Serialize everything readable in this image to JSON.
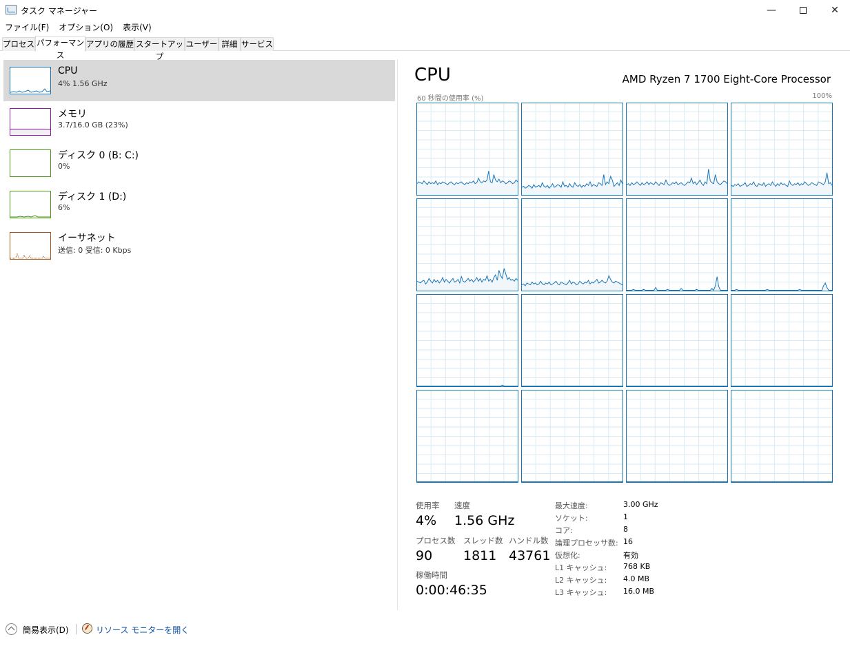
{
  "window": {
    "title": "タスク マネージャー",
    "min_symbol": "—",
    "close_symbol": "✕"
  },
  "menu": [
    "ファイル(F)",
    "オプション(O)",
    "表示(V)"
  ],
  "tabs": [
    "プロセス",
    "パフォーマンス",
    "アプリの履歴",
    "スタートアップ",
    "ユーザー",
    "詳細",
    "サービス"
  ],
  "active_tab": "パフォーマンス",
  "resources": [
    {
      "name": "CPU",
      "sub": "4%  1.56 GHz",
      "color": "#1b76b8",
      "selected": true
    },
    {
      "name": "メモリ",
      "sub": "3.7/16.0 GB (23%)",
      "color": "#8b18a6",
      "selected": false
    },
    {
      "name": "ディスク 0 (B: C:)",
      "sub": "0%",
      "color": "#4d9a16",
      "selected": false
    },
    {
      "name": "ディスク 1 (D:)",
      "sub": "6%",
      "color": "#4d9a16",
      "selected": false
    },
    {
      "name": "イーサネット",
      "sub": "送信: 0 受信: 0 Kbps",
      "color": "#a7581e",
      "selected": false
    }
  ],
  "detail": {
    "title": "CPU",
    "model": "AMD Ryzen 7 1700 Eight-Core Processor",
    "graph_label": "60 秒間の使用率 (%)",
    "graph_max": "100%",
    "graph_color": "#1b76b8",
    "grid_color": "#d9eaf7"
  },
  "core_activity": [
    [
      12,
      14,
      13,
      12,
      15,
      13,
      11,
      14,
      12,
      13,
      12,
      15,
      11,
      13,
      12,
      14,
      13,
      12,
      11,
      13,
      14,
      12,
      11,
      13,
      12,
      13,
      14,
      12,
      11,
      13,
      12,
      14,
      13,
      15,
      12,
      13,
      18,
      14,
      13,
      15,
      14,
      16,
      26,
      14,
      13,
      22,
      16,
      14,
      17,
      13,
      15,
      14,
      12,
      13,
      15,
      14,
      12,
      13,
      16,
      14
    ],
    [
      8,
      9,
      7,
      8,
      10,
      9,
      7,
      11,
      8,
      9,
      10,
      8,
      13,
      9,
      8,
      10,
      7,
      9,
      12,
      8,
      9,
      11,
      10,
      8,
      14,
      9,
      10,
      8,
      12,
      9,
      8,
      13,
      10,
      9,
      11,
      8,
      10,
      9,
      12,
      10,
      14,
      9,
      11,
      10,
      9,
      13,
      12,
      10,
      22,
      11,
      14,
      12,
      20,
      16,
      9,
      11,
      13,
      10,
      16,
      12
    ],
    [
      11,
      12,
      10,
      13,
      11,
      12,
      14,
      12,
      10,
      13,
      11,
      12,
      14,
      11,
      13,
      12,
      11,
      14,
      12,
      10,
      13,
      12,
      11,
      16,
      12,
      10,
      11,
      13,
      12,
      14,
      11,
      12,
      13,
      11,
      10,
      12,
      14,
      13,
      18,
      12,
      14,
      11,
      13,
      16,
      12,
      10,
      14,
      12,
      28,
      15,
      13,
      12,
      22,
      14,
      12,
      11,
      13,
      15,
      14,
      12
    ],
    [
      10,
      9,
      11,
      10,
      12,
      9,
      10,
      11,
      13,
      9,
      10,
      12,
      11,
      14,
      10,
      9,
      12,
      11,
      10,
      13,
      9,
      11,
      12,
      10,
      14,
      11,
      9,
      12,
      10,
      13,
      11,
      12,
      10,
      9,
      15,
      11,
      10,
      12,
      11,
      13,
      10,
      12,
      11,
      14,
      12,
      10,
      11,
      13,
      12,
      11,
      10,
      14,
      13,
      12,
      11,
      14,
      24,
      12,
      13,
      10
    ],
    [
      10,
      9,
      8,
      10,
      11,
      7,
      9,
      13,
      10,
      8,
      12,
      9,
      11,
      8,
      10,
      14,
      9,
      12,
      10,
      8,
      11,
      13,
      9,
      10,
      12,
      8,
      15,
      10,
      9,
      11,
      13,
      10,
      12,
      9,
      11,
      14,
      10,
      13,
      9,
      12,
      11,
      16,
      10,
      12,
      9,
      14,
      17,
      11,
      22,
      16,
      13,
      24,
      18,
      12,
      14,
      11,
      12,
      10,
      13,
      11
    ],
    [
      6,
      7,
      5,
      8,
      7,
      6,
      9,
      7,
      8,
      6,
      7,
      10,
      7,
      6,
      8,
      7,
      9,
      6,
      7,
      8,
      10,
      7,
      6,
      9,
      8,
      7,
      6,
      8,
      11,
      7,
      9,
      8,
      6,
      7,
      10,
      8,
      7,
      9,
      8,
      11,
      7,
      9,
      8,
      10,
      12,
      8,
      9,
      11,
      9,
      8,
      10,
      16,
      12,
      9,
      8,
      10,
      9,
      8,
      7,
      6
    ],
    [
      0,
      0,
      0,
      0,
      1,
      0,
      0,
      0,
      0,
      0,
      1,
      0,
      0,
      0,
      0,
      0,
      0,
      3,
      0,
      0,
      0,
      0,
      0,
      0,
      1,
      0,
      0,
      0,
      0,
      0,
      0,
      0,
      2,
      0,
      0,
      0,
      0,
      0,
      0,
      0,
      0,
      1,
      0,
      0,
      0,
      0,
      0,
      0,
      0,
      0,
      2,
      0,
      5,
      15,
      4,
      0,
      0,
      0,
      0,
      0
    ],
    [
      0,
      0,
      0,
      1,
      0,
      0,
      0,
      0,
      0,
      0,
      0,
      0,
      0,
      0,
      0,
      0,
      0,
      0,
      0,
      0,
      0,
      1,
      0,
      0,
      0,
      0,
      0,
      0,
      0,
      0,
      0,
      0,
      0,
      0,
      0,
      0,
      0,
      0,
      0,
      0,
      1,
      0,
      0,
      0,
      0,
      0,
      0,
      0,
      0,
      0,
      0,
      0,
      0,
      0,
      5,
      8,
      3,
      0,
      0,
      0
    ],
    [
      0,
      0,
      0,
      0,
      0,
      0,
      0,
      0,
      0,
      0,
      0,
      0,
      0,
      0,
      0,
      0,
      0,
      0,
      0,
      0,
      0,
      0,
      0,
      0,
      0,
      0,
      0,
      0,
      0,
      0,
      0,
      0,
      0,
      0,
      0,
      0,
      0,
      0,
      0,
      0,
      0,
      0,
      0,
      0,
      0,
      0,
      0,
      0,
      0,
      0,
      1,
      0,
      0,
      0,
      0,
      0,
      0,
      0,
      0,
      0
    ],
    [
      0,
      0,
      0,
      0,
      0,
      0,
      0,
      0,
      0,
      0,
      0,
      0,
      0,
      0,
      0,
      0,
      0,
      0,
      0,
      0,
      0,
      0,
      0,
      0,
      0,
      0,
      0,
      0,
      0,
      0,
      0,
      0,
      0,
      0,
      0,
      0,
      0,
      0,
      0,
      0,
      0,
      0,
      0,
      0,
      0,
      0,
      0,
      0,
      0,
      0,
      0,
      0,
      0,
      0,
      0,
      0,
      0,
      0,
      0,
      0
    ],
    [
      0,
      0,
      0,
      0,
      0,
      0,
      0,
      0,
      0,
      0,
      0,
      0,
      0,
      0,
      0,
      0,
      0,
      0,
      0,
      0,
      0,
      0,
      0,
      0,
      0,
      0,
      0,
      0,
      0,
      0,
      0,
      0,
      0,
      0,
      0,
      0,
      0,
      0,
      0,
      0,
      0,
      0,
      0,
      0,
      0,
      0,
      0,
      0,
      0,
      0,
      0,
      0,
      0,
      0,
      0,
      0,
      0,
      0,
      0,
      0
    ],
    [
      0,
      0,
      0,
      0,
      0,
      0,
      0,
      0,
      0,
      0,
      0,
      0,
      0,
      0,
      0,
      0,
      0,
      0,
      0,
      0,
      0,
      0,
      0,
      0,
      0,
      0,
      0,
      0,
      0,
      0,
      0,
      0,
      0,
      0,
      0,
      0,
      0,
      0,
      0,
      0,
      0,
      0,
      0,
      0,
      0,
      0,
      0,
      0,
      0,
      0,
      0,
      0,
      0,
      0,
      0,
      0,
      0,
      0,
      0,
      0
    ],
    [
      0,
      0,
      0,
      0,
      0,
      0,
      0,
      0,
      0,
      0,
      0,
      0,
      0,
      0,
      0,
      0,
      0,
      0,
      0,
      0,
      0,
      0,
      0,
      0,
      0,
      0,
      0,
      0,
      0,
      0,
      0,
      0,
      0,
      0,
      0,
      0,
      0,
      0,
      0,
      0,
      0,
      0,
      0,
      0,
      0,
      0,
      0,
      0,
      0,
      0,
      0,
      0,
      0,
      0,
      0,
      0,
      0,
      0,
      0,
      0
    ],
    [
      0,
      0,
      0,
      0,
      0,
      0,
      0,
      0,
      0,
      0,
      0,
      0,
      0,
      0,
      0,
      0,
      0,
      0,
      0,
      0,
      0,
      0,
      0,
      0,
      0,
      0,
      0,
      0,
      0,
      0,
      0,
      0,
      0,
      0,
      0,
      0,
      0,
      0,
      0,
      0,
      0,
      0,
      0,
      0,
      0,
      0,
      0,
      0,
      0,
      0,
      0,
      0,
      0,
      0,
      0,
      0,
      0,
      0,
      0,
      0
    ],
    [
      0,
      0,
      0,
      0,
      0,
      0,
      0,
      0,
      0,
      0,
      0,
      0,
      0,
      0,
      0,
      0,
      0,
      0,
      0,
      0,
      0,
      0,
      0,
      0,
      0,
      0,
      0,
      0,
      0,
      0,
      0,
      0,
      0,
      0,
      0,
      0,
      0,
      0,
      0,
      0,
      0,
      0,
      0,
      0,
      0,
      0,
      0,
      0,
      0,
      0,
      0,
      0,
      0,
      0,
      0,
      0,
      0,
      0,
      0,
      0
    ],
    [
      0,
      0,
      0,
      0,
      0,
      0,
      0,
      0,
      0,
      0,
      0,
      0,
      0,
      0,
      0,
      0,
      0,
      0,
      0,
      0,
      0,
      0,
      0,
      0,
      0,
      0,
      0,
      0,
      0,
      0,
      0,
      0,
      0,
      0,
      0,
      0,
      0,
      0,
      0,
      0,
      0,
      0,
      0,
      0,
      0,
      0,
      0,
      0,
      0,
      0,
      0,
      0,
      0,
      0,
      0,
      0,
      0,
      0,
      0,
      0
    ]
  ],
  "stats": {
    "usage_label": "使用率",
    "usage": "4%",
    "speed_label": "速度",
    "speed": "1.56 GHz",
    "processes_label": "プロセス数",
    "processes": "90",
    "threads_label": "スレッド数",
    "threads": "1811",
    "handles_label": "ハンドル数",
    "handles": "43761",
    "uptime_label": "稼働時間",
    "uptime": "0:00:46:35"
  },
  "specs": [
    {
      "key": "最大速度:",
      "value": "3.00 GHz"
    },
    {
      "key": "ソケット:",
      "value": "1"
    },
    {
      "key": "コア:",
      "value": "8"
    },
    {
      "key": "論理プロセッサ数:",
      "value": "16"
    },
    {
      "key": "仮想化:",
      "value": "有効"
    },
    {
      "key": "L1 キャッシュ:",
      "value": "768 KB"
    },
    {
      "key": "L2 キャッシュ:",
      "value": "4.0 MB"
    },
    {
      "key": "L3 キャッシュ:",
      "value": "16.0 MB"
    }
  ],
  "footer": {
    "fewer_details": "簡易表示(D)",
    "resource_monitor": "リソース モニターを開く"
  }
}
